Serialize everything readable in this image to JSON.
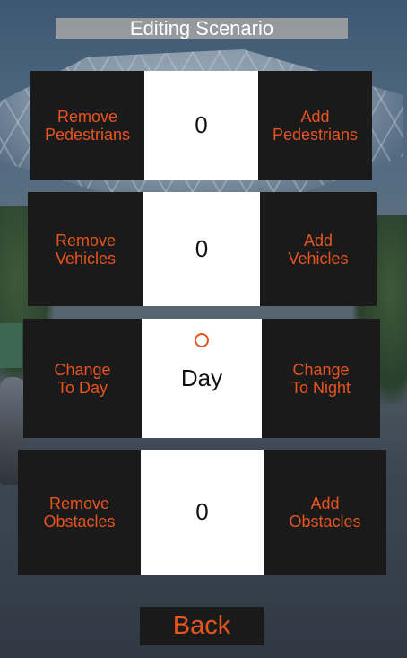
{
  "title": "Editing Scenario",
  "rows": [
    {
      "left_label": "Remove\nPedestrians",
      "value": "0",
      "right_label": "Add\nPedestrians"
    },
    {
      "left_label": "Remove\nVehicles",
      "value": "0",
      "right_label": "Add\nVehicles"
    },
    {
      "left_label": "Change\nTo Day",
      "value": "Day",
      "right_label": "Change\nTo Night"
    },
    {
      "left_label": "Remove\nObstacles",
      "value": "0",
      "right_label": "Add\nObstacles"
    }
  ],
  "back_label": "Back",
  "colors": {
    "accent": "#e8541f",
    "button_bg": "#1a1a1a",
    "value_bg": "#ffffff",
    "title_bg": "#a5a5a5"
  },
  "icons": {
    "day_indicator": "record-icon"
  }
}
